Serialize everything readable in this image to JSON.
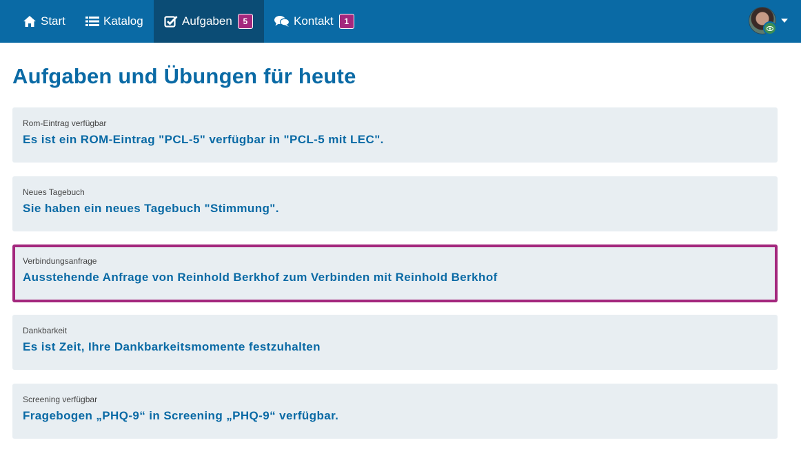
{
  "nav": {
    "items": [
      {
        "label": "Start",
        "icon": "home-icon"
      },
      {
        "label": "Katalog",
        "icon": "list-icon"
      },
      {
        "label": "Aufgaben",
        "icon": "check-square-icon",
        "badge": "5",
        "active": true
      },
      {
        "label": "Kontakt",
        "icon": "comments-icon",
        "badge": "1"
      }
    ],
    "user_menu": {
      "avatar": "user-avatar",
      "status_icon": "eye-icon",
      "caret": "caret-down-icon"
    }
  },
  "page": {
    "title": "Aufgaben und Übungen für heute"
  },
  "tasks": [
    {
      "category": "Rom-Eintrag verfügbar",
      "message": "Es ist ein ROM-Eintrag \"PCL-5\" verfügbar in \"PCL-5 mit LEC\"."
    },
    {
      "category": "Neues Tagebuch",
      "message": "Sie haben ein neues Tagebuch \"Stimmung\"."
    },
    {
      "category": "Verbindungsanfrage",
      "message": "Ausstehende Anfrage von Reinhold Berkhof zum Verbinden mit Reinhold Berkhof",
      "highlighted": true
    },
    {
      "category": "Dankbarkeit",
      "message": "Es ist Zeit, Ihre Dankbarkeitsmomente festzuhalten"
    },
    {
      "category": "Screening verfügbar",
      "message": "Fragebogen „PHQ-9“ in Screening „PHQ-9“ verfügbar."
    }
  ],
  "colors": {
    "navbar": "#0a6aa5",
    "navbar_active": "#0b4c75",
    "badge": "#a3277d",
    "highlight_border": "#a3277d",
    "card_bg": "#e8eef2",
    "accent_text": "#0a6aa5"
  }
}
